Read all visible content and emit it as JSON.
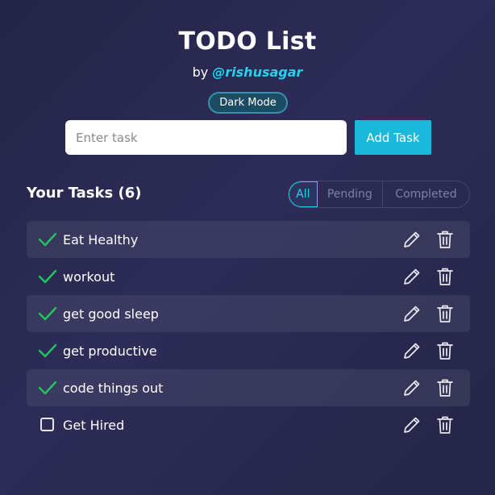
{
  "header": {
    "title": "TODO List",
    "by_prefix": "by",
    "handle": "@rishusagar",
    "mode_toggle": "Dark Mode"
  },
  "input": {
    "placeholder": "Enter task",
    "value": "",
    "add_label": "Add Task"
  },
  "tasks_heading": "Your Tasks (6)",
  "filters": [
    {
      "label": "All",
      "active": true
    },
    {
      "label": "Pending",
      "active": false
    },
    {
      "label": "Completed",
      "active": false
    }
  ],
  "tasks": [
    {
      "text": "Eat Healthy",
      "completed": true
    },
    {
      "text": "workout",
      "completed": true
    },
    {
      "text": "get good sleep",
      "completed": true
    },
    {
      "text": "get productive",
      "completed": true
    },
    {
      "text": "code things out",
      "completed": true
    },
    {
      "text": "Get Hired",
      "completed": false
    }
  ],
  "colors": {
    "accent": "#22d3ee",
    "add_button": "#1ab8db",
    "check": "#22c55e",
    "background": "#2a2a52"
  },
  "icons": {
    "completed": "check-icon",
    "pending": "checkbox-icon",
    "edit": "pencil-icon",
    "delete": "trash-icon"
  }
}
